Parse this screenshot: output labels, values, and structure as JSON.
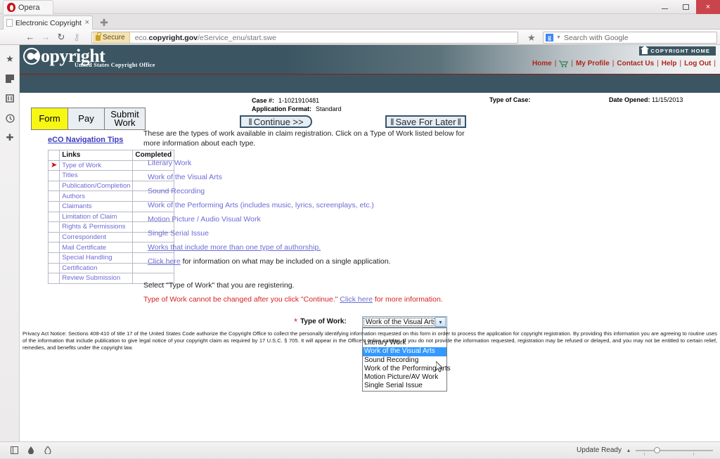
{
  "browser": {
    "app_name": "Opera",
    "tab_title": "Electronic Copyright O...",
    "tab_close_glyph": "×",
    "new_tab_glyph": "✚",
    "back_glyph": "←",
    "forward_glyph": "→",
    "reload_glyph": "↻",
    "key_glyph": "⚷",
    "secure_label": "Secure",
    "url_prefix": "eco.",
    "url_domain": "copyright.gov",
    "url_path": "/eService_enu/start.swe",
    "star_glyph": "★",
    "google_letter": "g",
    "search_placeholder": "Search with Google",
    "window_close_glyph": "×",
    "rail_icons": [
      "star-icon",
      "notes-icon",
      "sync-icon",
      "history-icon",
      "add-icon"
    ]
  },
  "site_header": {
    "logo_main": "opyright",
    "logo_sub": "United States Copyright Office",
    "copyright_home_label": "COPYRIGHT HOME",
    "nav": [
      {
        "label": "Home",
        "type": "link"
      },
      {
        "label": "cart-icon",
        "type": "icon"
      },
      {
        "label": "My Profile",
        "type": "link"
      },
      {
        "label": "Contact Us",
        "type": "link"
      },
      {
        "label": "Help",
        "type": "link"
      },
      {
        "label": "Log Out",
        "type": "link"
      }
    ],
    "separator": "|"
  },
  "steps": {
    "items": [
      {
        "label": "Form",
        "active": true
      },
      {
        "label": "Pay",
        "active": false
      },
      {
        "label": "Submit Work",
        "active": false
      }
    ],
    "nav_tips_label": "eCO Navigation Tips"
  },
  "case_info": {
    "case_label": "Case #:",
    "case_value": "1-1021910481",
    "format_label": "Application Format:",
    "format_value": "Standard",
    "type_of_case_label": "Type of Case:",
    "type_of_case_value": "",
    "date_opened_label": "Date Opened:",
    "date_opened_value": "11/15/2013"
  },
  "links_table": {
    "header_links": "Links",
    "header_completed": "Completed",
    "current_marker": "➤",
    "rows": [
      {
        "label": "Type of Work",
        "completed": "",
        "current": true
      },
      {
        "label": "Titles",
        "completed": "",
        "current": false
      },
      {
        "label": "Publication/Completion",
        "completed": "",
        "current": false
      },
      {
        "label": "Authors",
        "completed": "",
        "current": false
      },
      {
        "label": "Claimants",
        "completed": "",
        "current": false
      },
      {
        "label": "Limitation of Claim",
        "completed": "",
        "current": false
      },
      {
        "label": "Rights & Permissions",
        "completed": "",
        "current": false
      },
      {
        "label": "Correspondent",
        "completed": "",
        "current": false
      },
      {
        "label": "Mail Certificate",
        "completed": "",
        "current": false
      },
      {
        "label": "Special Handling",
        "completed": "",
        "current": false
      },
      {
        "label": "Certification",
        "completed": "",
        "current": false
      },
      {
        "label": "Review Submission",
        "completed": "",
        "current": false
      }
    ]
  },
  "actions": {
    "continue_label": "Continue >>",
    "save_label": "Save For Later",
    "bar_glyph": "‖"
  },
  "main": {
    "intro": "These are the types of work available in claim registration. Click on a Type of Work listed below for more information about each type.",
    "work_types": [
      "Literary Work",
      "Work of the Visual Arts",
      "Sound Recording",
      "Work of the Performing Arts (includes music, lyrics, screenplays, etc.)",
      "Motion Picture / Audio Visual Work",
      "Single Serial Issue",
      "Works that include more than one type of authorship."
    ],
    "click_here_label": "Click here",
    "click_here_rest": " for information on what may be included on a single application.",
    "select_instruction": "Select \"Type of Work\" that you are registering.",
    "warning_text": "Type of Work cannot be changed after you click \"Continue.\" ",
    "warning_link": "Click here",
    "warning_rest": " for more information."
  },
  "type_of_work_field": {
    "required_marker": "*",
    "label": "Type of Work:",
    "selected_value": "Work of the Visual Arts",
    "caret_glyph": "▾",
    "open": true,
    "options": [
      "",
      "Literary Work",
      "Work of the Visual Arts",
      "Sound Recording",
      "Work of the Performing Arts",
      "Motion Picture/AV Work",
      "Single Serial Issue"
    ],
    "highlighted_option": "Work of the Visual Arts"
  },
  "privacy_notice": "Privacy Act Notice: Sections 408-410 of title 17 of the United States Code authorize the Copyright Office to collect the personally identifying information requested on this form in order to process the application for copyright registration. By providing this information you are agreeing to routine uses of the information that include publication to give legal notice of your copyright claim as required by 17 U.S.C. § 705. It will appear in the Office's online catalog. If you do not provide the information requested, registration may be refused or delayed, and you may not be entitled to certain relief, remedies, and benefits under the copyright law.",
  "status_bar": {
    "update_label": "Update Ready",
    "caret_glyph": "▴",
    "icons": [
      "panel-icon",
      "downloads-icon",
      "extensions-icon"
    ]
  }
}
